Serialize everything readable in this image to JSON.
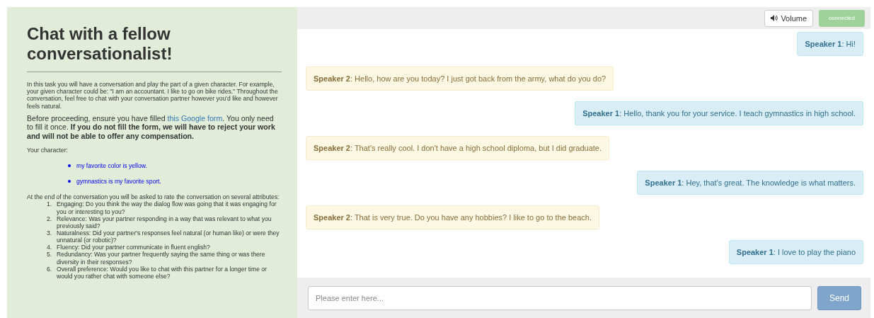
{
  "task_panel": {
    "title": "Chat with a fellow conversationalist!",
    "intro": "In this task you will have a conversation and play the part of a given character. For example, your given character could be: \"I am an accountant. I like to go on bike rides.\" Throughout the conversation, feel free to chat with your conversation partner however you'd like and however feels natural.",
    "notice": {
      "before_link": "Before proceeding, ensure you have filled",
      "link": "this Google form",
      "after_link": ". You only need to fill it once. **If you do not fill the form, we will have to reject your work and will not be able to offer any compensation.**"
    },
    "character_label": "Your character:",
    "character": [
      "my favorite color is yellow.",
      "gymnastics is my favorite sport."
    ],
    "rating_intro": "At the end of the conversation you will be asked to rate the conversation on several attributes:",
    "attributes": [
      {
        "number": "1.",
        "text": "Engaging: Do you think the way the dialog flow was going that it was engaging for you or interesting to you?"
      },
      {
        "number": "2.",
        "text": "Relevance: Was your partner responding in a way that was relevant to what you previously said?"
      },
      {
        "number": "3.",
        "text": "Naturalness: Did your partner's responses feel natural (or human like) or were they unnatural (or robotic)?"
      },
      {
        "number": "4.",
        "text": "Fluency: Did your partner communicate in fluent english?"
      },
      {
        "number": "5.",
        "text": "Redundancy: Was your partner frequently saying the same thing or was there diversity in their responses?"
      },
      {
        "number": "6.",
        "text": "Overall preference: Would you like to chat with this partner for a longer time or would you rather chat with someone else?"
      }
    ]
  },
  "toolbar": {
    "volume_button": "Volume",
    "status": "connected"
  },
  "messages": [
    {
      "kind": "self",
      "text": "**Speaker 1**: Hi!"
    },
    {
      "kind": "partner",
      "text": "**Speaker 2**: Hello, how are you today? I just got back from the army, what do you do?"
    },
    {
      "kind": "self",
      "text": "**Speaker 1**: Hello, thank you for your service. I teach gymnastics in high school."
    },
    {
      "kind": "partner",
      "text": "**Speaker 2**: That's really cool. I don't have a high school diploma, but I did graduate."
    },
    {
      "kind": "self",
      "text": "**Speaker 1**: Hey, that's great. The knowledge is what matters."
    },
    {
      "kind": "partner",
      "text": "**Speaker 2**: That is very true. Do you have any hobbies? I like to go to the beach."
    },
    {
      "kind": "self",
      "text": "**Speaker 1**: I love to play the piano"
    }
  ],
  "composer": {
    "placeholder": "Please enter here...",
    "send_button": "Send"
  }
}
